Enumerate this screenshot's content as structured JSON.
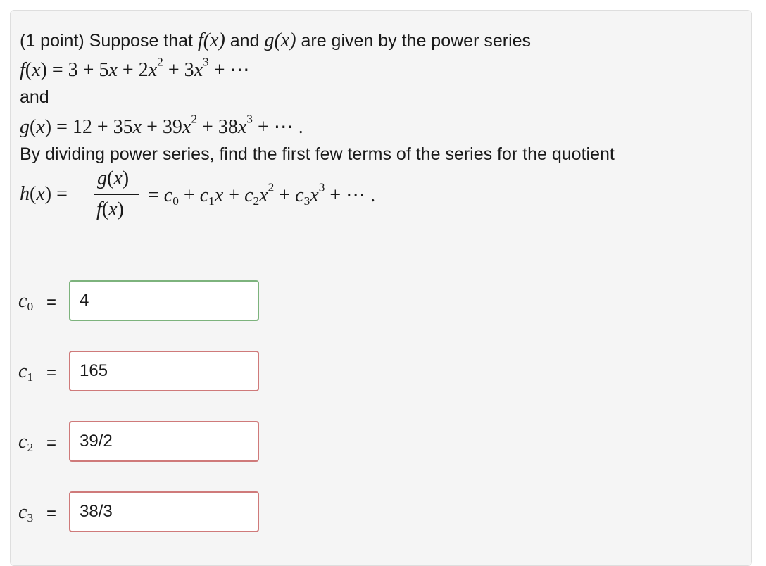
{
  "problem": {
    "intro_prefix": "(1 point) Suppose that",
    "intro_and": "and",
    "intro_suffix": "are given by the power series",
    "and_word": "and",
    "dividing_text": "By dividing power series, find the first few terms of the series for the quotient"
  },
  "math": {
    "f_name": "f",
    "g_name": "g",
    "h_name": "h",
    "f_series": "f(x) = 3 + 5x + 2x² + 3x³ + ⋯",
    "g_series": "g(x) = 12 + 35x + 39x² + 38x³ + ⋯ .",
    "quotient_numerator": "g(x)",
    "quotient_denominator": "f(x)",
    "quotient_rhs": "= c₀ + c₁x + c₂x² + c₃x³ + ⋯ ."
  },
  "answers": [
    {
      "label": "c",
      "sub": "0",
      "value": "4",
      "status": "correct"
    },
    {
      "label": "c",
      "sub": "1",
      "value": "165",
      "status": "incorrect"
    },
    {
      "label": "c",
      "sub": "2",
      "value": "39/2",
      "status": "incorrect"
    },
    {
      "label": "c",
      "sub": "3",
      "value": "38/3",
      "status": "incorrect"
    }
  ],
  "equals_sign": "=",
  "colors": {
    "correct_border": "#7db37d",
    "incorrect_border": "#cf7a7a",
    "panel_background": "#f5f5f5"
  }
}
